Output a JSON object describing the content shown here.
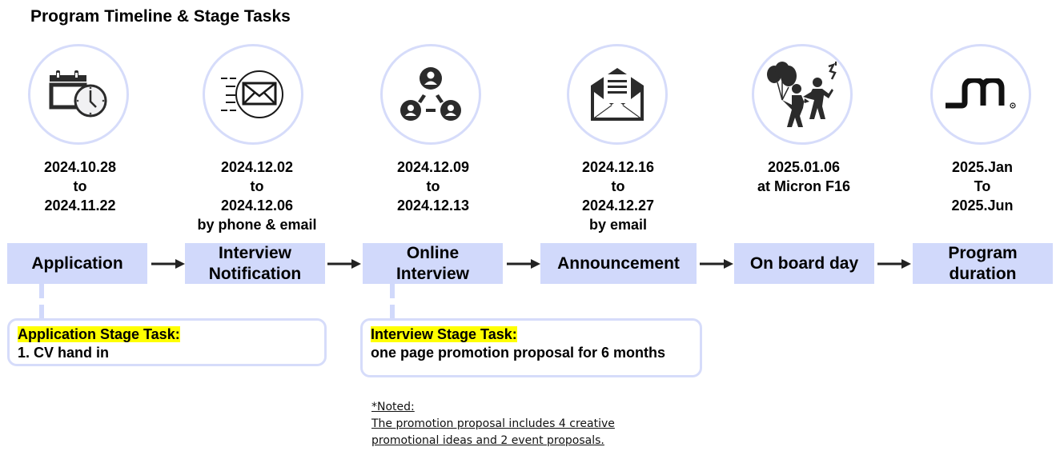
{
  "title": "Program Timeline & Stage Tasks",
  "colors": {
    "stage_fill": "#d1d9fb",
    "circle_border": "#d6dcfa",
    "highlight": "#ffff00",
    "arrow": "#222222"
  },
  "stages": [
    {
      "icon": "calendar-clock-icon",
      "dates": [
        "2024.10.28",
        "to",
        "2024.11.22"
      ],
      "label_lines": [
        "Application"
      ]
    },
    {
      "icon": "fast-email-icon",
      "dates": [
        "2024.12.02",
        "to",
        "2024.12.06",
        "by phone & email"
      ],
      "label_lines": [
        "Interview",
        "Notification"
      ]
    },
    {
      "icon": "network-people-icon",
      "dates": [
        "2024.12.09",
        "to",
        "2024.12.13"
      ],
      "label_lines": [
        "Online",
        "Interview"
      ]
    },
    {
      "icon": "open-envelope-icon",
      "dates": [
        "2024.12.16",
        "to",
        "2024.12.27",
        "by email"
      ],
      "label_lines": [
        "Announcement"
      ]
    },
    {
      "icon": "celebration-icon",
      "dates": [
        "2025.01.06",
        "at Micron F16"
      ],
      "label_lines": [
        "On board day"
      ]
    },
    {
      "icon": "micron-logo-icon",
      "dates": [
        "2025.Jan",
        "To",
        "2025.Jun"
      ],
      "label_lines": [
        "Program",
        "duration"
      ]
    }
  ],
  "tasks": [
    {
      "heading": "Application Stage Task:",
      "body": "1. CV hand in"
    },
    {
      "heading": "Interview Stage Task:",
      "body": "one page promotion proposal for 6 months"
    }
  ],
  "note": {
    "heading": "*Noted:",
    "lines": [
      "The promotion proposal includes 4 creative",
      "promotional ideas and 2 event proposals."
    ]
  }
}
